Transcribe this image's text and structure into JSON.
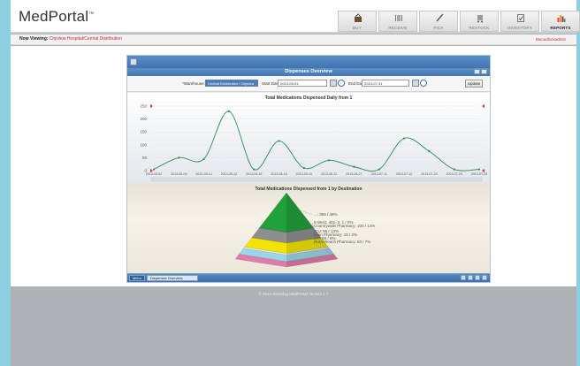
{
  "app": {
    "logo": "MedPortal",
    "logo_mark": "™"
  },
  "nav": [
    {
      "label": "BUY",
      "icon": "basket-icon"
    },
    {
      "label": "RECEIVE",
      "icon": "barcode-icon"
    },
    {
      "label": "PICK",
      "icon": "pen-icon"
    },
    {
      "label": "RESTOCK",
      "icon": "cart-icon"
    },
    {
      "label": "INVENTORY",
      "icon": "clipboard-icon"
    },
    {
      "label": "REPORTS",
      "icon": "bar-chart-icon",
      "active": true
    }
  ],
  "subbar": {
    "prefix": "Now Viewing:",
    "location": "Cityview Hospital/Central Distribution",
    "user": "Bwoodlockadmin"
  },
  "window": {
    "title": "Dispenses Overview",
    "filters": {
      "warehouse_label": "*Warehouse:",
      "warehouse_value": "Central Distribution / Cityview I…",
      "start_label": "Start Date:",
      "start_value": "2013-05-01",
      "end_label": "End Date:",
      "end_value": "2013-07-31",
      "update_label": "Update"
    }
  },
  "chart_data": [
    {
      "type": "line",
      "title": "Total Medications Dispensed Daily from 1",
      "x": [
        "2013-05-02",
        "2013-05-09",
        "2013-05-14",
        "2013-05-12",
        "2013-05-15",
        "2013-05-18",
        "2013-05-19",
        "2013-06-22",
        "2013-06-27",
        "2013-07-11",
        "2013-07-12",
        "2013-07-23",
        "2013-07-24",
        "2013-07-25"
      ],
      "series": [
        {
          "values": [
            5,
            50,
            45,
            230,
            5,
            115,
            10,
            40,
            15,
            5,
            125,
            75,
            5,
            5
          ],
          "color": "#2e8b57"
        }
      ],
      "ylim": [
        0,
        250
      ],
      "y_ticks": [
        0,
        50,
        100,
        150,
        200,
        250
      ],
      "grid": true
    },
    {
      "type": "pyramid",
      "title": "Total Medications Dispensed from 1 by Destination",
      "slices": [
        {
          "label": "...: 365 / 48%",
          "value": 365,
          "percent": 48,
          "color": "#22a03c"
        },
        {
          "label": "6-West, 401, 2: 1 / 0%",
          "value": 1,
          "percent": 0,
          "color": "#5e9bd6"
        },
        {
          "label": "Countrywide Pharmacy: 100 / 14%",
          "value": 100,
          "percent": 14,
          "color": "#8e8e8e"
        },
        {
          "label": "ICU: 95 / 13%",
          "value": 95,
          "percent": 13,
          "color": "#f2e400"
        },
        {
          "label": "Main Pharmacy: 15 / 2%",
          "value": 15,
          "percent": 2,
          "color": "#e8e8e8"
        },
        {
          "label": "OR: 60 / 8%",
          "value": 60,
          "percent": 8,
          "color": "#9ad6e8"
        },
        {
          "label": "Rural Reach Pharmacy: 50 / 7%",
          "value": 50,
          "percent": 7,
          "color": "#e07ca8"
        }
      ]
    }
  ],
  "taskbar": {
    "menu_label": "Menu",
    "task_label": "Dispenses Overview"
  },
  "footer": {
    "copyright": "© 2013 Swisslog  MedPortal Version 1.7"
  }
}
